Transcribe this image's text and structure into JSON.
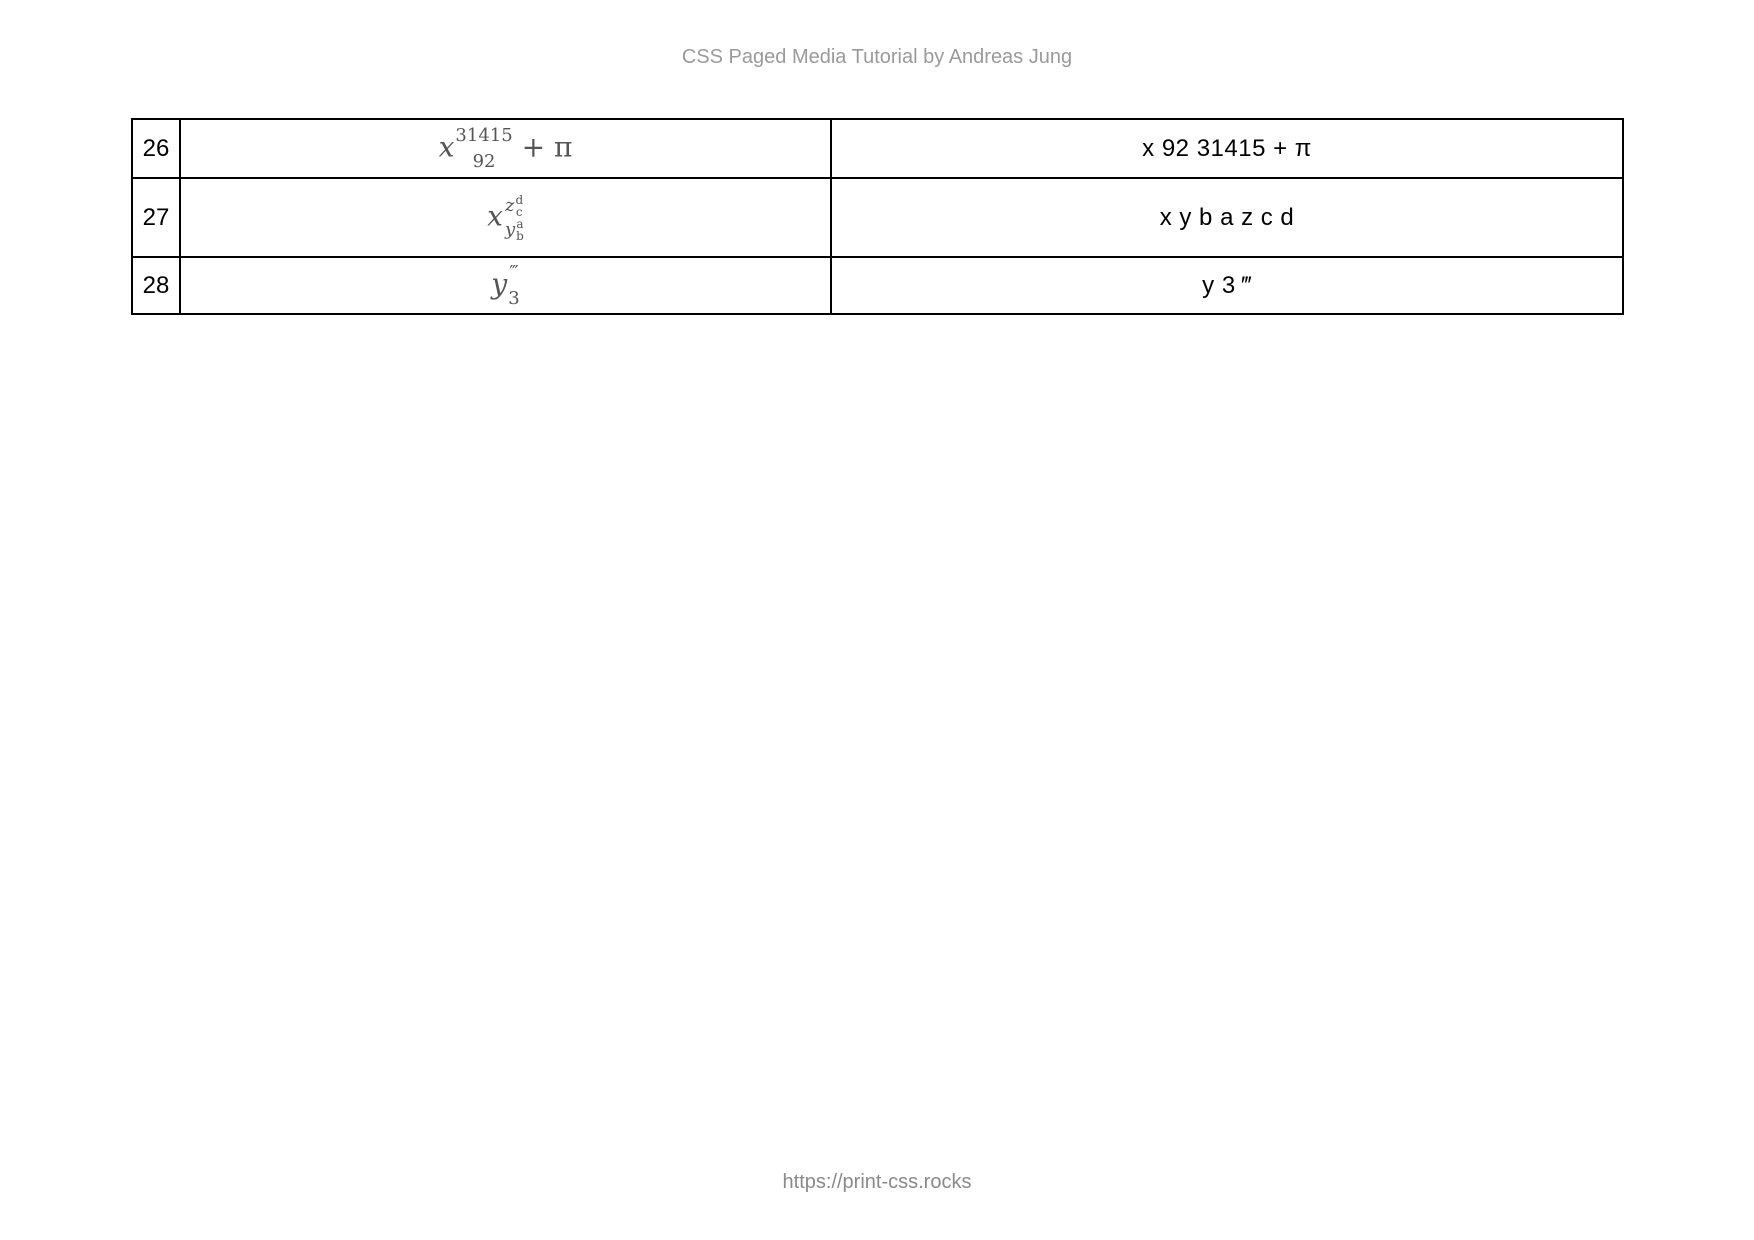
{
  "header": {
    "title": "CSS Paged Media Tutorial by Andreas Jung"
  },
  "footer": {
    "url": "https://print-css.rocks"
  },
  "rows": [
    {
      "number": "26",
      "formula": {
        "base": "x",
        "sup": "31415",
        "sub": "92",
        "rest": "+ π"
      },
      "text": "x 92 31415 + π"
    },
    {
      "number": "27",
      "formula": {
        "base": "x",
        "sup_base": "z",
        "sup_sup": "d",
        "sup_sub": "c",
        "sub_base": "y",
        "sub_sup": "a",
        "sub_sub": "b"
      },
      "text": "x y b a z c d"
    },
    {
      "number": "28",
      "formula": {
        "base": "y",
        "sup": "‴",
        "sub": "3"
      },
      "text": "y 3 ‴"
    }
  ]
}
